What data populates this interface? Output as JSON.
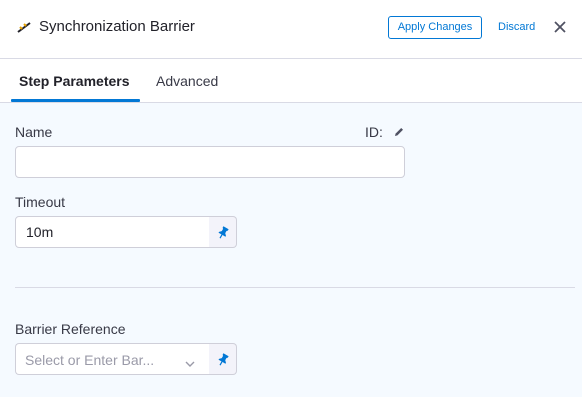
{
  "header": {
    "title": "Synchronization Barrier",
    "apply_label": "Apply Changes",
    "discard_label": "Discard",
    "icons": {
      "step": "barrier-step-icon",
      "close": "close-icon"
    }
  },
  "tabs": [
    {
      "label": "Step Parameters",
      "active": true
    },
    {
      "label": "Advanced",
      "active": false
    }
  ],
  "form": {
    "name": {
      "label": "Name",
      "value": "",
      "id_label": "ID:"
    },
    "timeout": {
      "label": "Timeout",
      "value": "10m"
    },
    "barrier_reference": {
      "label": "Barrier Reference",
      "placeholder": "Select or Enter Bar..."
    }
  },
  "colors": {
    "accent": "#0278d5",
    "panel_bg": "#f5faff",
    "border": "#cfcfd9"
  }
}
